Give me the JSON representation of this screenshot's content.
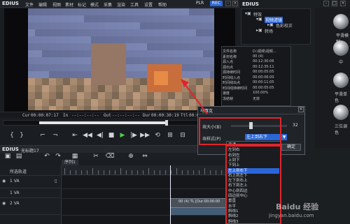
{
  "app": {
    "title": "EDIUS",
    "menus": [
      "文件",
      "编辑",
      "视图",
      "素材",
      "标记",
      "模式",
      "采集",
      "渲染",
      "工具",
      "设置",
      "帮助"
    ],
    "plr": "PLR",
    "rec": "REC"
  },
  "preview": {
    "timecodes": [
      {
        "label": "Cur",
        "value": "00:00:07:17"
      },
      {
        "label": "In",
        "value": "--:--:--:--"
      },
      {
        "label": "Out",
        "value": "--:--:--:--"
      },
      {
        "label": "Dur",
        "value": "00:00:30:19"
      },
      {
        "label": "Ttl",
        "value": "00:00:20:02"
      }
    ]
  },
  "timeline": {
    "title": "EDIUS",
    "project": "无标题17",
    "sequence_tab": "序列1",
    "tracks": [
      {
        "name": "1 VA"
      },
      {
        "name": "1 VA"
      },
      {
        "name": "2 VA"
      },
      {
        "name": "A"
      }
    ],
    "track_header_label": "所选轨道",
    "clip_label": "00 (4) TL [Dur:00:00:00"
  },
  "effects_panel": {
    "title": "EDIUS",
    "tree": [
      "特效",
      "视频滤镜",
      "色彩校正",
      "转场"
    ],
    "balls": [
      "平滑模糊",
      "中",
      "平滑单色",
      "三位调色"
    ]
  },
  "info_panel": {
    "rows": [
      {
        "k": "文件名称",
        "v": "D:\\视频\\视频..."
      },
      {
        "k": "素材名称",
        "v": "00 (4)"
      },
      {
        "k": "源入点",
        "v": "00:12:30:06"
      },
      {
        "k": "源出点",
        "v": "00:12:35:11"
      },
      {
        "k": "源持续时间",
        "v": "00:00:05:05"
      },
      {
        "k": "时间线入点",
        "v": "00:00:06:00"
      },
      {
        "k": "时间线出点",
        "v": "00:00:11:05"
      },
      {
        "k": "时间线持续时间",
        "v": "00:00:05:05"
      },
      {
        "k": "速度",
        "v": "100.00%"
      },
      {
        "k": "冻结帧",
        "v": "无效"
      }
    ]
  },
  "dialog": {
    "title": "马赛克",
    "size_label": "块大小(B)",
    "size_value": "32",
    "style_label": "块样式(P)",
    "style_value": "左上到右下",
    "ok": "确定",
    "options": [
      "普通",
      "左到右",
      "右到左",
      "上到下",
      "下到上",
      "左上到右下",
      "右上到左下",
      "左下到右上",
      "右下到左上",
      "中心到四边",
      "四边到中心",
      "垂直",
      "水平",
      "斜线1",
      "斜线2",
      "斜线3"
    ],
    "selected_index": 5
  },
  "watermark": {
    "line1": "Baidu 经验",
    "line2": "jingyan.baidu.com"
  },
  "colors": {
    "accent": "#2a66d8",
    "highlight_box": "#e0252a"
  }
}
